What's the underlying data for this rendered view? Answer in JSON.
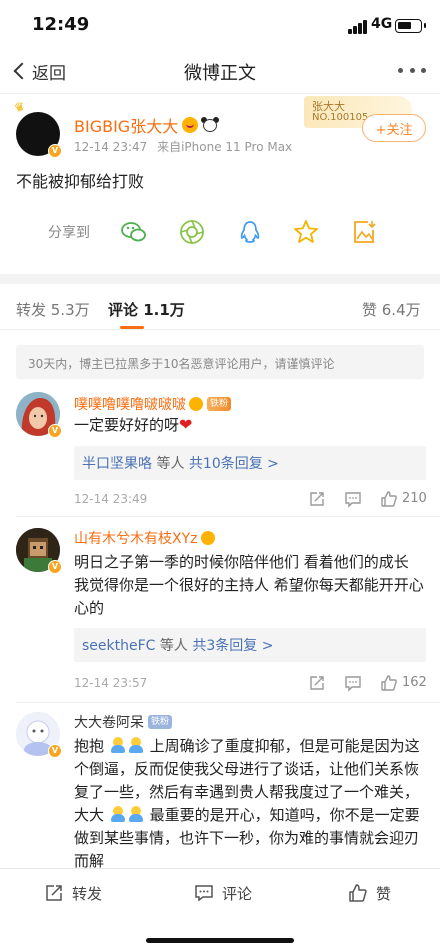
{
  "status_bar": {
    "time": "12:49",
    "network": "4G"
  },
  "nav": {
    "back_label": "返回",
    "title": "微博正文"
  },
  "post": {
    "author": "BIGBIG张大大",
    "time": "12-14 23:47",
    "source": "来自iPhone 11 Pro Max",
    "fan_card_name": "张大大",
    "fan_card_no": "NO.100105",
    "follow_label": "+关注",
    "text": "不能被抑郁给打败",
    "share_label": "分享到",
    "share_targets": [
      "wechat-icon",
      "moments-icon",
      "qq-icon",
      "qzone-icon",
      "save-image-icon"
    ]
  },
  "tabs": {
    "repost": "转发 5.3万",
    "comment": "评论 1.1万",
    "like": "赞 6.4万"
  },
  "notice": "30天内，博主已拉黑多于10名恶意评论用户，请谨慎评论",
  "comments": [
    {
      "name": "噗噗噜噗噜啵啵啵",
      "fan_tag": "铁粉",
      "text": "一定要好好的呀",
      "reply_user": "半口坚果咯",
      "reply_mid": " 等人 ",
      "reply_count": "共10条回复 >",
      "time": "12-14 23:49",
      "likes": "210"
    },
    {
      "name": "山有木兮木有枝XYz",
      "text": "明日之子第一季的时候你陪伴他们 看着他们的成长 我觉得你是一个很好的主持人 希望你每天都能开开心心的",
      "reply_user": "seektheFC",
      "reply_mid": " 等人 ",
      "reply_count": "共3条回复 >",
      "time": "12-14 23:57",
      "likes": "162"
    },
    {
      "name": "大大卷阿呆",
      "fan_tag": "铁粉",
      "text_a": "抱抱",
      "text_b": "上周确诊了重度抑郁，但是可能是因为这个倒逼，反而促使我父母进行了谈话，让他们关系恢复了一些，然后有幸遇到贵人帮我度过了一个难关，大大",
      "text_c": "最重要的是开心，知道吗，你不是一定要做到某些事情，也许下一秒，你为难的事情就会迎刃而解"
    }
  ],
  "bottom_bar": {
    "repost": "转发",
    "comment": "评论",
    "like": "赞"
  }
}
